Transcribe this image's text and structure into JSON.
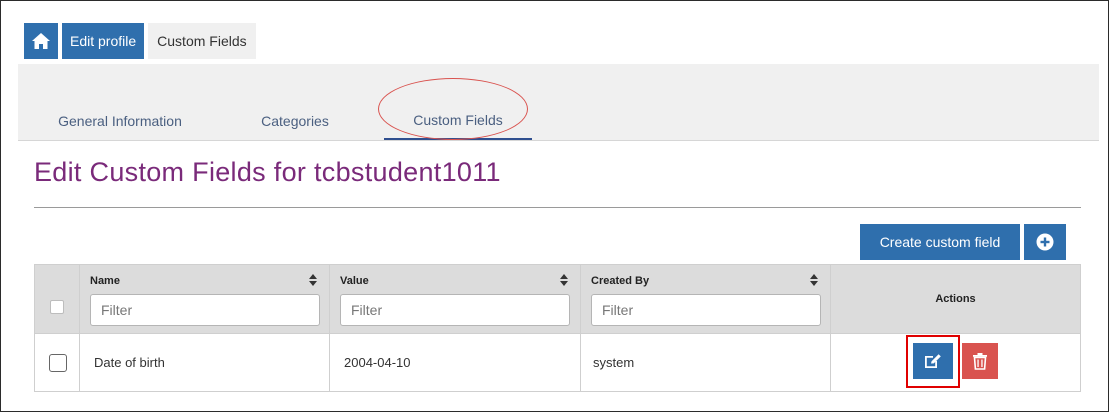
{
  "breadcrumb": {
    "home_icon": "home-icon",
    "items": [
      {
        "label": "Edit profile"
      },
      {
        "label": "Custom Fields"
      }
    ]
  },
  "tabs": [
    {
      "label": "General Information",
      "active": false
    },
    {
      "label": "Categories",
      "active": false
    },
    {
      "label": "Custom Fields",
      "active": true
    }
  ],
  "page": {
    "title": "Edit Custom Fields for tcbstudent1011"
  },
  "toolbar": {
    "create_label": "Create custom field",
    "add_icon": "plus-circle-icon"
  },
  "table": {
    "columns": [
      {
        "label": "Name",
        "filter_placeholder": "Filter"
      },
      {
        "label": "Value",
        "filter_placeholder": "Filter"
      },
      {
        "label": "Created By",
        "filter_placeholder": "Filter"
      },
      {
        "label": "Actions"
      }
    ],
    "rows": [
      {
        "name": "Date of birth",
        "value": "2004-04-10",
        "created_by": "system"
      }
    ],
    "action_icons": {
      "edit": "edit-icon",
      "delete": "trash-icon"
    }
  },
  "colors": {
    "primary": "#2f6fad",
    "danger": "#d9534f",
    "title": "#7a2a7a",
    "annotation": "#e00000"
  }
}
